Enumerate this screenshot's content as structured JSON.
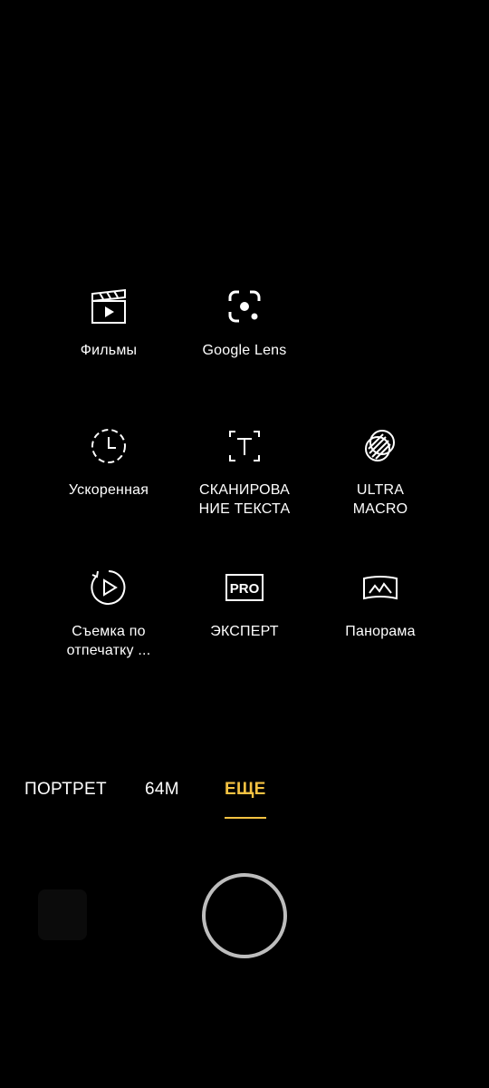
{
  "modes": [
    {
      "label": "Фильмы",
      "icon": "clapperboard-icon"
    },
    {
      "label": "Google Lens",
      "icon": "google-lens-icon"
    },
    {
      "label": "Ускоренная",
      "icon": "timelapse-clock-icon"
    },
    {
      "label": "СКАНИРОВА\nНИЕ ТЕКСТА",
      "icon": "text-scan-icon"
    },
    {
      "label": "ULTRA\nMACRO",
      "icon": "macro-lens-icon"
    },
    {
      "label": "Съемка по\nотпечатку ...",
      "icon": "fingerprint-shot-icon"
    },
    {
      "label": "ЭКСПЕРТ",
      "icon": "pro-mode-icon"
    },
    {
      "label": "Панорама",
      "icon": "panorama-icon"
    }
  ],
  "tabs": [
    {
      "label": "ПОРТРЕТ",
      "active": false
    },
    {
      "label": "64M",
      "active": false
    },
    {
      "label": "ЕЩЕ",
      "active": true
    }
  ],
  "colors": {
    "accent": "#f5c242",
    "background": "#000000",
    "shutter_ring": "#bdbdbd"
  }
}
